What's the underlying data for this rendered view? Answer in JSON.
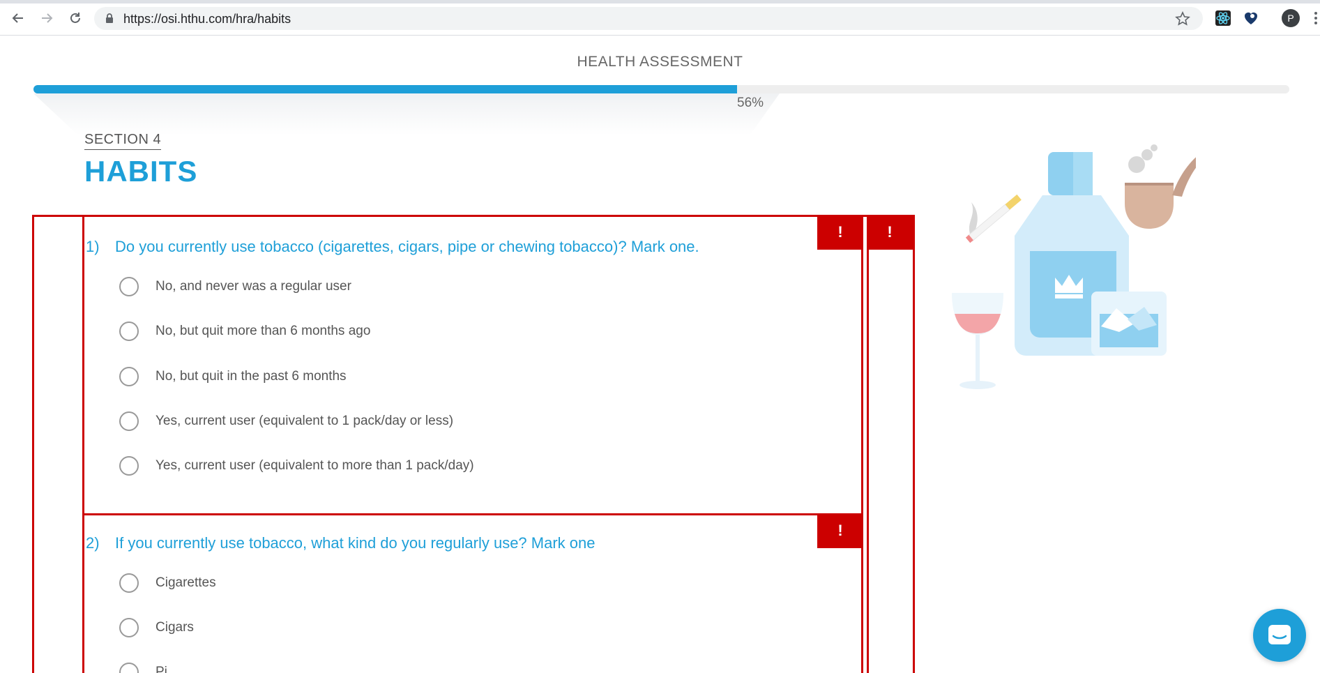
{
  "browser": {
    "url": "https://osi.hthu.com/hra/habits",
    "profile_initial": "P"
  },
  "header": {
    "title": "HEALTH ASSESSMENT",
    "progress_percent": 56,
    "progress_label": "56%"
  },
  "section": {
    "label": "SECTION 4",
    "title": "HABITS"
  },
  "validation": {
    "badge_symbol": "!",
    "color": "#cc0000"
  },
  "questions": [
    {
      "number": "1)",
      "text": "Do you currently use tobacco (cigarettes, cigars, pipe or chewing tobacco)? Mark one.",
      "options": [
        "No, and never was a regular user",
        "No, but quit more than 6 months ago",
        "No, but quit in the past 6 months",
        "Yes, current user (equivalent to 1 pack/day or less)",
        "Yes, current user (equivalent to more than 1 pack/day)"
      ]
    },
    {
      "number": "2)",
      "text": "If you currently use tobacco, what kind do you regularly use? Mark one",
      "options": [
        "Cigarettes",
        "Cigars",
        "Pi..."
      ]
    }
  ],
  "colors": {
    "accent": "#1e9fd8",
    "error": "#cc0000",
    "text": "#555555"
  },
  "icons": {
    "back": "arrow-left-icon",
    "forward": "arrow-right-icon",
    "reload": "reload-icon",
    "lock": "lock-icon",
    "bookmark": "star-icon",
    "chat": "chat-icon"
  }
}
